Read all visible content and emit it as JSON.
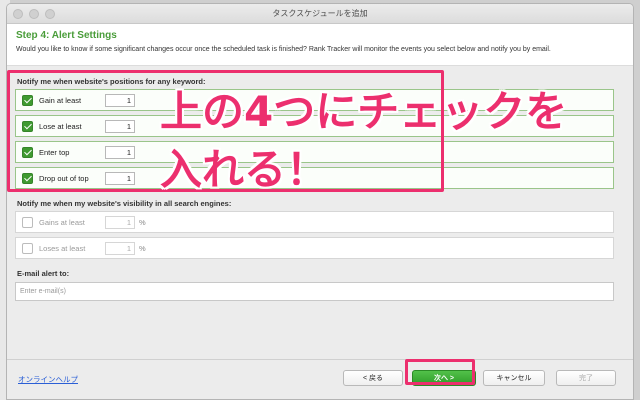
{
  "window": {
    "title": "タスクスケジュールを追加"
  },
  "header": {
    "step_title": "Step 4: Alert Settings",
    "description": "Would you like to know if some significant changes occur once the scheduled task is finished? Rank Tracker will monitor the events you select below and notify you by email."
  },
  "positions": {
    "label": "Notify me when website's positions for any keyword:",
    "rows": [
      {
        "label": "Gain at least",
        "value": "1",
        "checked": true
      },
      {
        "label": "Lose at least",
        "value": "1",
        "checked": true
      },
      {
        "label": "Enter top",
        "value": "1",
        "checked": true
      },
      {
        "label": "Drop out of top",
        "value": "1",
        "checked": true
      }
    ]
  },
  "visibility": {
    "label": "Notify me when my website's visibility in all search engines:",
    "rows": [
      {
        "label": "Gains at least",
        "value": "1",
        "unit": "%",
        "checked": false
      },
      {
        "label": "Loses at least",
        "value": "1",
        "unit": "%",
        "checked": false
      }
    ]
  },
  "email": {
    "label": "E-mail alert to:",
    "placeholder": "Enter e-mail(s)"
  },
  "footer": {
    "help_link": "オンラインヘルプ",
    "back": "< 戻る",
    "next": "次へ >",
    "cancel": "キャンセル",
    "finish": "完了"
  },
  "annotation": {
    "line1": "上の4つにチェックを",
    "line2": "入れる！",
    "color": "#ec2f6e"
  },
  "colors": {
    "accent_green": "#3f9a30",
    "step_title": "#4a9d3a"
  }
}
